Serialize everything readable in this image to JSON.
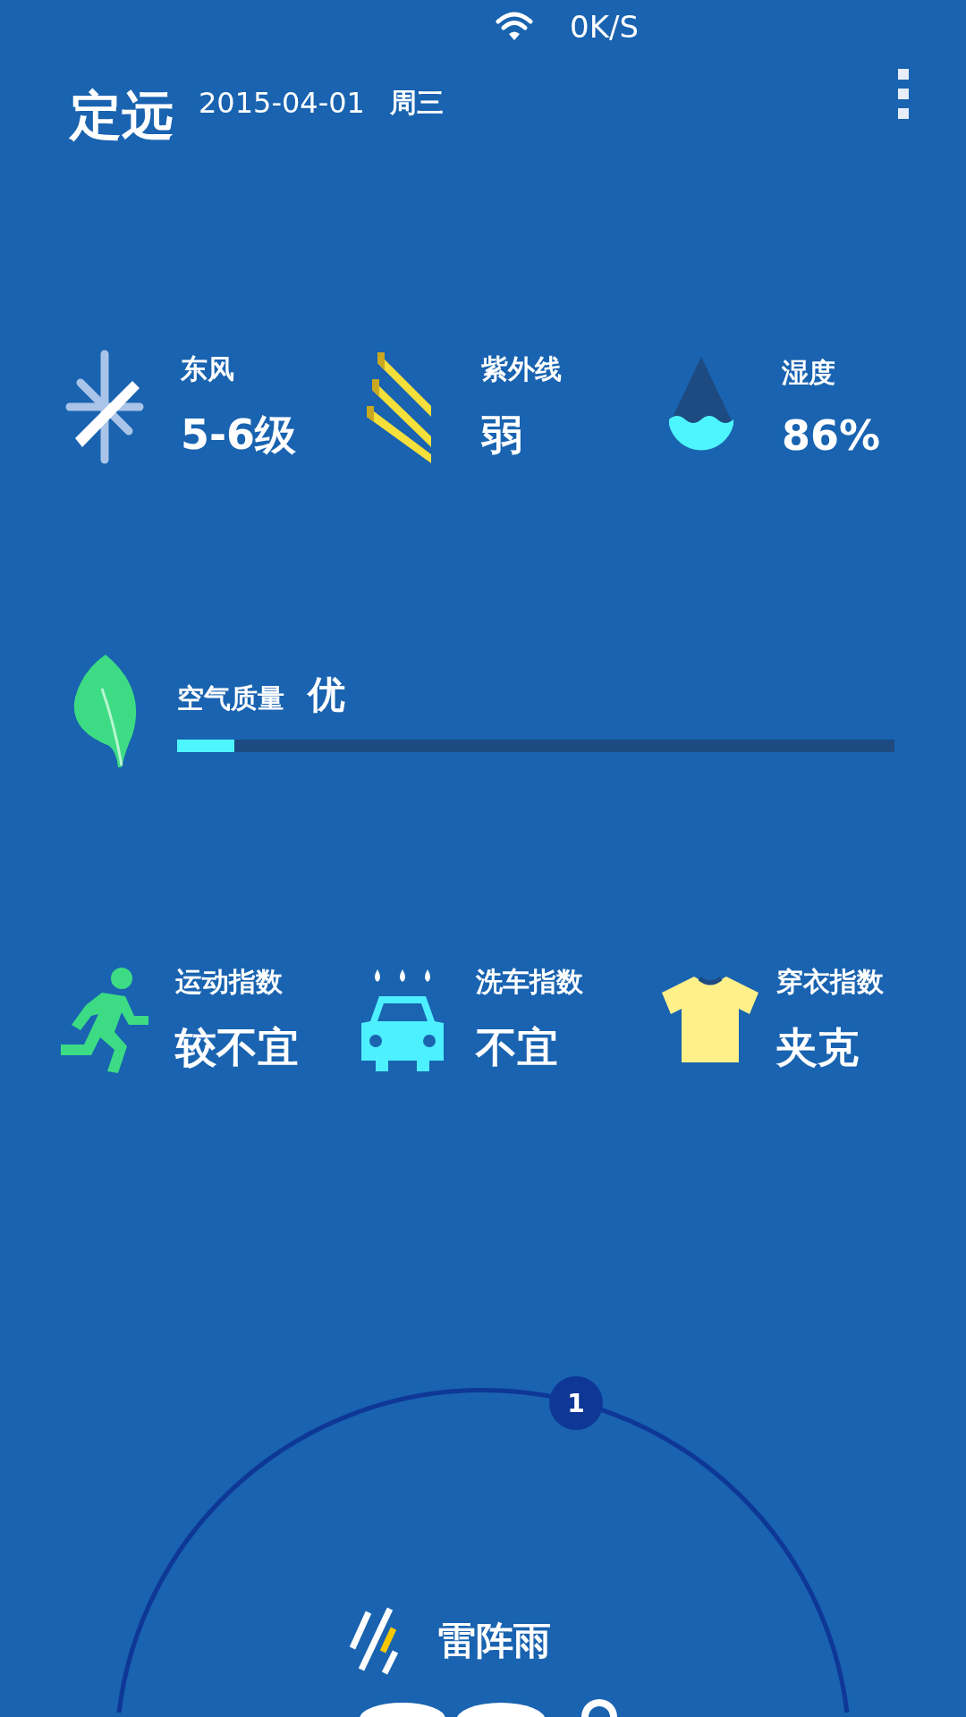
{
  "status_bar": {
    "net_speed": "0K/S"
  },
  "header": {
    "city": "定远",
    "date": "2015-04-01",
    "weekday": "周三"
  },
  "details": [
    {
      "kind": "wind",
      "label": "东风",
      "value": "5-6级"
    },
    {
      "kind": "uv",
      "label": "紫外线",
      "value": "弱"
    },
    {
      "kind": "humidity",
      "label": "湿度",
      "value": "86%"
    }
  ],
  "air_quality": {
    "label": "空气质量",
    "value": "优",
    "level": 0.08
  },
  "indices": [
    {
      "kind": "sport",
      "label": "运动指数",
      "value": "较不宜"
    },
    {
      "kind": "carwash",
      "label": "洗车指数",
      "value": "不宜"
    },
    {
      "kind": "clothing",
      "label": "穿衣指数",
      "value": "夹克"
    }
  ],
  "forecast": {
    "badge": "1",
    "condition": "雷阵雨"
  }
}
